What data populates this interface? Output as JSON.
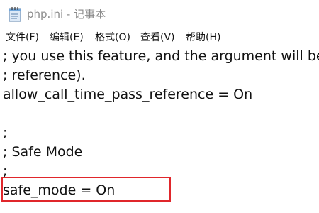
{
  "window": {
    "title": "php.ini - 记事本",
    "icon": "notepad-icon"
  },
  "menu": {
    "items": [
      "文件(F)",
      "编辑(E)",
      "格式(O)",
      "查看(V)",
      "帮助(H)"
    ]
  },
  "editor": {
    "lines": [
      "; you use this feature, and the argument will be",
      "; reference).",
      "allow_call_time_pass_reference = On",
      "",
      ";",
      "; Safe Mode",
      ";",
      "safe_mode = On"
    ]
  },
  "colors": {
    "highlight_border": "#e0262b",
    "title_text": "#8a8a8a"
  }
}
